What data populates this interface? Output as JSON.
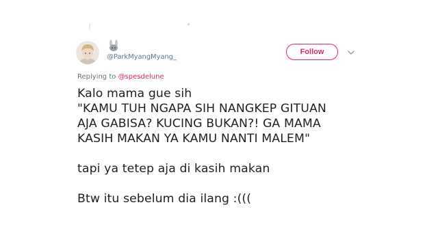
{
  "tweet": {
    "author": {
      "handle": "@ParkMyangMyang_",
      "badge_icon": "bunny-icon"
    },
    "follow_label": "Follow",
    "accent_color": "#e0245e",
    "replying_label": "Replying to",
    "replying_to": "@spesdelune",
    "paragraphs": [
      [
        "Kalo mama gue sih",
        "\"KAMU TUH NGAPA SIH NANGKEP GITUAN",
        "AJA GABISA? KUCING BUKAN?! GA MAMA",
        "KASIH MAKAN YA KAMU NANTI MALEM\""
      ],
      [
        "tapi ya tetep aja di kasih makan"
      ],
      [
        "Btw itu sebelum dia ilang :((("
      ]
    ]
  }
}
